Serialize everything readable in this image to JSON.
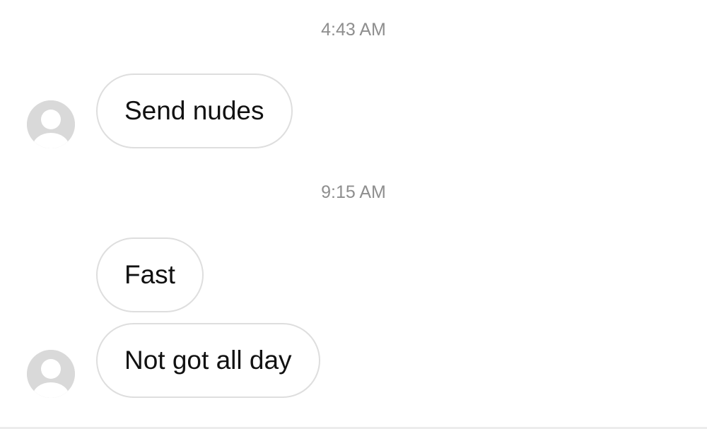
{
  "conversation": {
    "timestamps": [
      "4:43 AM",
      "9:15 AM"
    ],
    "messages": [
      {
        "text": "Send nudes",
        "sender": "other"
      },
      {
        "text": "Fast",
        "sender": "other"
      },
      {
        "text": "Not got all day",
        "sender": "other"
      }
    ]
  },
  "colors": {
    "background": "#ffffff",
    "bubble_border": "#dedede",
    "timestamp_text": "#8e8e8e",
    "avatar_placeholder": "#d9d9d9"
  },
  "icons": {
    "avatar": "default-user-avatar-icon"
  }
}
